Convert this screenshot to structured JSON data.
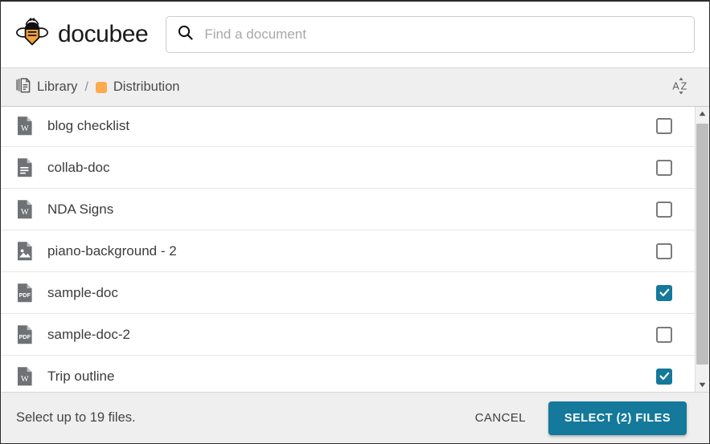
{
  "app": {
    "brand_name": "docubee",
    "logo_icon": "bee-icon",
    "brand_accent": "#F2A13B",
    "primary_color": "#14799A"
  },
  "search": {
    "icon": "search-icon",
    "placeholder": "Find a document",
    "value": ""
  },
  "breadcrumb": {
    "library_icon": "documents-icon",
    "library_label": "Library",
    "separator": "/",
    "folder_color": "#FBAA4F",
    "folder_label": "Distribution",
    "sort_icon": "sort-az-icon"
  },
  "files": [
    {
      "name": "blog checklist",
      "type": "word",
      "icon": "word-file-icon",
      "checked": false
    },
    {
      "name": "collab-doc",
      "type": "doc",
      "icon": "document-file-icon",
      "checked": false
    },
    {
      "name": "NDA Signs",
      "type": "word",
      "icon": "word-file-icon",
      "checked": false
    },
    {
      "name": "piano-background - 2",
      "type": "image",
      "icon": "image-file-icon",
      "checked": false
    },
    {
      "name": "sample-doc",
      "type": "pdf",
      "icon": "pdf-file-icon",
      "checked": true
    },
    {
      "name": "sample-doc-2",
      "type": "pdf",
      "icon": "pdf-file-icon",
      "checked": false
    },
    {
      "name": "Trip outline",
      "type": "word",
      "icon": "word-file-icon",
      "checked": true
    }
  ],
  "scrollbar": {
    "up_icon": "scroll-up-arrow-icon",
    "down_icon": "scroll-down-arrow-icon"
  },
  "footer": {
    "note": "Select up to 19 files.",
    "cancel_label": "CANCEL",
    "select_label": "SELECT (2) FILES"
  }
}
